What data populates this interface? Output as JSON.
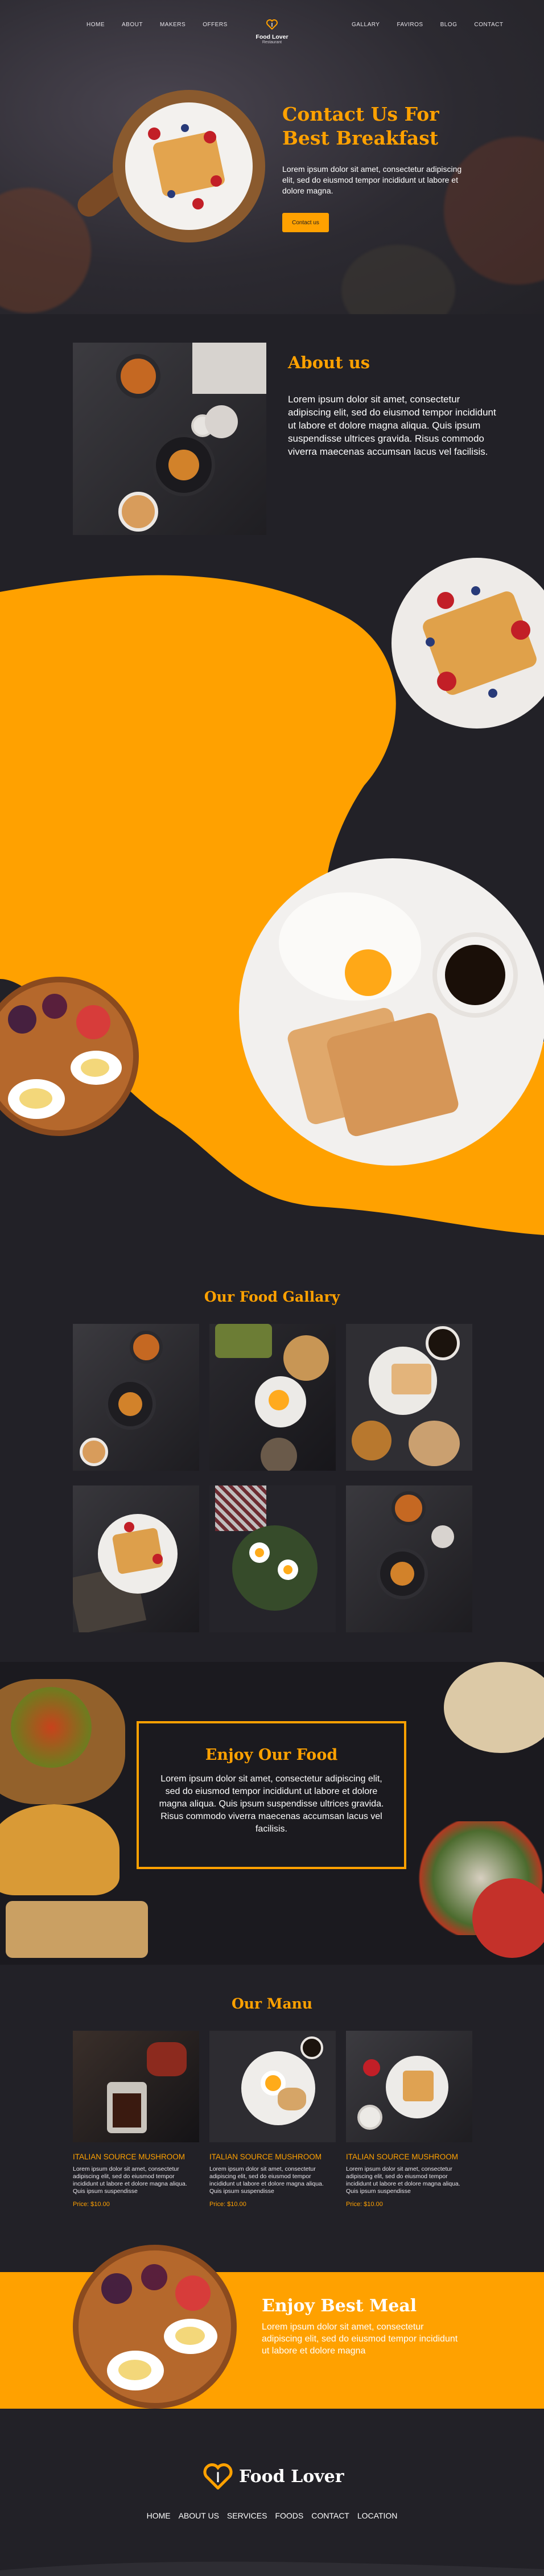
{
  "header": {
    "nav_left": [
      "HOME",
      "ABOUT",
      "MAKERS",
      "OFFERS"
    ],
    "nav_right": [
      "GALLARY",
      "FAVIROS",
      "BLOG",
      "CONTACT"
    ],
    "logo_title": "Food Lover",
    "logo_sub": "Restaurant",
    "logo_icon": "heart-fork-icon"
  },
  "hero": {
    "title_line1": "Contact Us For",
    "title_line2": "Best Breakfast",
    "text": "Lorem ipsum dolor sit amet, consectetur adipiscing elit, sed do eiusmod tempor incididunt ut labore et dolore magna.",
    "button": "Contact us"
  },
  "about": {
    "title": "About us",
    "text": "Lorem ipsum dolor sit amet, consectetur adipiscing elit, sed do eiusmod tempor incididunt ut labore et dolore magna aliqua. Quis ipsum suspendisse ultrices gravida. Risus commodo viverra maecenas accumsan lacus vel facilisis."
  },
  "gallery": {
    "title": "Our Food Gallary"
  },
  "enjoy": {
    "title": "Enjoy Our Food",
    "text": "Lorem ipsum dolor sit amet, consectetur adipiscing elit, sed do eiusmod tempor incididunt ut labore et dolore magna aliqua. Quis ipsum suspendisse ultrices gravida. Risus commodo viverra maecenas accumsan lacus vel facilisis."
  },
  "menu": {
    "title": "Our Manu",
    "items": [
      {
        "name": "ITALIAN SOURCE MUSHROOM",
        "desc": "Lorem ipsum dolor sit amet, consectetur adipiscing elit, sed do eiusmod tempor incididunt ut labore et dolore magna aliqua. Quis ipsum suspendisse",
        "price": "Price: $10.00"
      },
      {
        "name": "ITALIAN SOURCE MUSHROOM",
        "desc": "Lorem ipsum dolor sit amet, consectetur adipiscing elit, sed do eiusmod tempor incididunt ut labore et dolore magna aliqua. Quis ipsum suspendisse",
        "price": "Price: $10.00"
      },
      {
        "name": "ITALIAN SOURCE MUSHROOM",
        "desc": "Lorem ipsum dolor sit amet, consectetur adipiscing elit, sed do eiusmod tempor incididunt ut labore et dolore magna aliqua. Quis ipsum suspendisse",
        "price": "Price: $10.00"
      }
    ]
  },
  "best": {
    "title": "Enjoy Best Meal",
    "text": "Lorem ipsum dolor sit amet, consectetur adipiscing elit, sed do eiusmod tempor incididunt ut labore et dolore magna"
  },
  "footer": {
    "logo": "Food Lover",
    "nav": [
      "HOME",
      "ABOUT US",
      "SERVICES",
      "FOODS",
      "CONTACT",
      "LOCATION"
    ]
  },
  "colors": {
    "accent": "#ffa100",
    "background": "#222127"
  }
}
